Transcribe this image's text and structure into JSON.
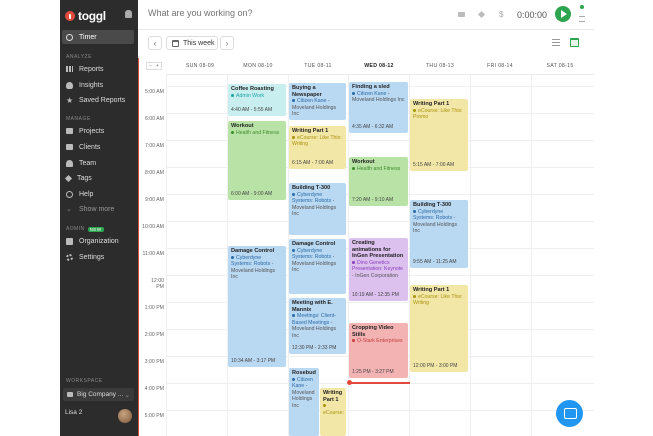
{
  "app": {
    "logo": "toggl"
  },
  "sidebar": {
    "timer": "Timer",
    "analyze_header": "ANALYZE",
    "analyze": [
      "Reports",
      "Insights",
      "Saved Reports"
    ],
    "manage_header": "MANAGE",
    "manage": [
      "Projects",
      "Clients",
      "Team",
      "Tags",
      "Help",
      "Show more"
    ],
    "admin_header": "ADMIN",
    "admin_badge": "NEW",
    "admin": [
      "Organization",
      "Settings"
    ],
    "workspace_header": "WORKSPACE",
    "workspace": "Big Company ...",
    "user": "Lisa 2"
  },
  "topbar": {
    "placeholder": "What are you working on?",
    "dollar": "$",
    "time": "0:00:00"
  },
  "toolbar": {
    "prev": "‹",
    "next": "›",
    "range": "This week"
  },
  "calendar": {
    "zoom_minus": "−",
    "zoom_plus": "+",
    "days": [
      "SUN 08-09",
      "MON 08-10",
      "TUE 08-11",
      "WED 08-12",
      "THU 08-13",
      "FRI 08-14",
      "SAT 08-15"
    ],
    "hours": [
      "5:00 AM",
      "6:00 AM",
      "7:00 AM",
      "8:00 AM",
      "9:00 AM",
      "10:00 AM",
      "11:00 AM",
      "12:00 PM",
      "1:00 PM",
      "2:00 PM",
      "3:00 PM",
      "4:00 PM",
      "5:00 PM"
    ],
    "events": [
      {
        "title": "Coffee Roasting",
        "project": "Admin Work",
        "client": "",
        "time": "4:40 AM - 5:55 AM"
      },
      {
        "title": "Workout",
        "project": "Health and Fitness",
        "client": "",
        "time": "6:00 AM - 9:00 AM"
      },
      {
        "title": "Damage Control",
        "project": "Cyberdyne Systems: Robots",
        "client": "- Moveland Holdings Inc",
        "time": "10:34 AM - 3:17 PM"
      },
      {
        "title": "Buying a Newspaper",
        "project": "Citizen Kane",
        "client": "- Moveland Holdings Inc",
        "time": ""
      },
      {
        "title": "Writing Part 1",
        "project": "eCourse: Like This: Writing",
        "client": "",
        "time": "6:15 AM - 7:00 AM"
      },
      {
        "title": "Building T-300",
        "project": "Cyberdyne Systems: Robots",
        "client": "- Moveland Holdings Inc",
        "time": ""
      },
      {
        "title": "Damage Control",
        "project": "Cyberdyne Systems: Robots",
        "client": "- Moveland Holdings Inc",
        "time": ""
      },
      {
        "title": "Meeting with E. Mannix",
        "project": "Meetings: Client-Based Meetings",
        "client": "- Moveland Holdings Inc",
        "time": "12:30 PM - 2:33 PM"
      },
      {
        "title": "Rosebud",
        "project": "Citizen Kane",
        "client": "- Moveland Holdings Inc",
        "time": ""
      },
      {
        "title": "Writing Part 1",
        "project": "eCourse:",
        "client": "",
        "time": ""
      },
      {
        "title": "Finding a sled",
        "project": "Citizen Kane",
        "client": "- Moveland Holdings Inc",
        "time": "4:35 AM - 6:32 AM"
      },
      {
        "title": "Workout",
        "project": "Health and Fitness",
        "client": "",
        "time": "7:20 AM - 9:10 AM"
      },
      {
        "title": "Creating animations for InGen Presentation",
        "project": "Dino Genetics Presentation: Keynote",
        "client": "- InGen Corporation",
        "time": "10:19 AM - 12:35 PM"
      },
      {
        "title": "Cropping Video Stills",
        "project": "O-Stark Enterprises",
        "client": "",
        "time": "1:25 PM - 3:27 PM"
      },
      {
        "title": "Writing Part 1",
        "project": "eCourse: Like This: Promo",
        "client": "",
        "time": "5:15 AM - 7:00 AM"
      },
      {
        "title": "Building T-300",
        "project": "Cyberdyne Systems: Robots",
        "client": "- Moveland Holdings Inc",
        "time": "9:55 AM - 11:25 AM"
      },
      {
        "title": "Writing Part 1",
        "project": "eCourse: Like This: Writing",
        "client": "",
        "time": "12:00 PM - 3:00 PM"
      }
    ]
  },
  "colors": {
    "accent": "#2da44e",
    "brand": "#e24a3b",
    "sidebar": "#2c2c2c",
    "chat": "#2196f3"
  }
}
